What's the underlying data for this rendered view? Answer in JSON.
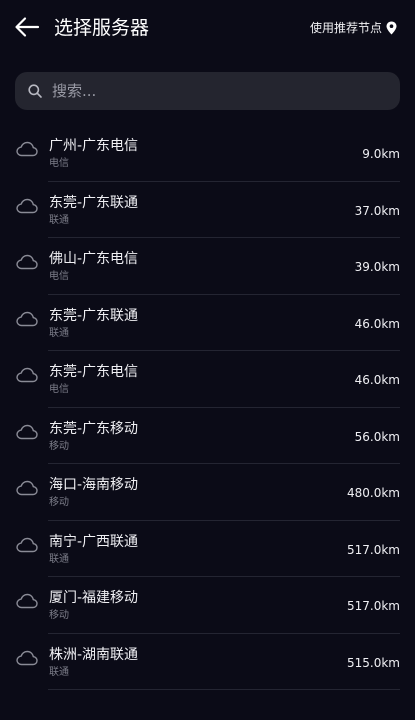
{
  "header": {
    "title": "选择服务器",
    "recommend_label": "使用推荐节点",
    "back_icon": "arrow-left-icon",
    "location_icon": "location-pin-icon"
  },
  "search": {
    "placeholder": "搜索...",
    "value": "",
    "icon": "search-icon"
  },
  "servers": [
    {
      "name": "广州-广东电信",
      "isp": "电信",
      "distance": "9.0km"
    },
    {
      "name": "东莞-广东联通",
      "isp": "联通",
      "distance": "37.0km"
    },
    {
      "name": "佛山-广东电信",
      "isp": "电信",
      "distance": "39.0km"
    },
    {
      "name": "东莞-广东联通",
      "isp": "联通",
      "distance": "46.0km"
    },
    {
      "name": "东莞-广东电信",
      "isp": "电信",
      "distance": "46.0km"
    },
    {
      "name": "东莞-广东移动",
      "isp": "移动",
      "distance": "56.0km"
    },
    {
      "name": "海口-海南移动",
      "isp": "移动",
      "distance": "480.0km"
    },
    {
      "name": "南宁-广西联通",
      "isp": "联通",
      "distance": "517.0km"
    },
    {
      "name": "厦门-福建移动",
      "isp": "移动",
      "distance": "517.0km"
    },
    {
      "name": "株洲-湖南联通",
      "isp": "联通",
      "distance": "515.0km"
    }
  ],
  "colors": {
    "background": "#0b0b17",
    "search_background": "#24252f",
    "divider": "#242532",
    "primary_text": "#f0f0f4",
    "secondary_text": "#7b7c88"
  }
}
